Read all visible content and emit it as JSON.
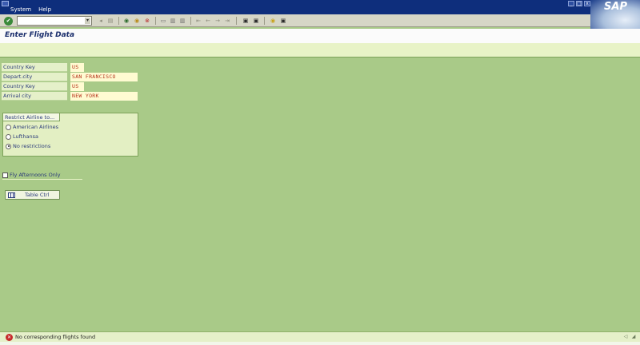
{
  "menu": {
    "items": [
      "System",
      "Help"
    ]
  },
  "window_controls": [
    "_",
    "□",
    "x"
  ],
  "brand": {
    "logo_text": "SAP"
  },
  "toolbar": {
    "command_field_value": "",
    "history_icon": "▾",
    "icons": [
      "enter-icon",
      "back-icon",
      "exit-icon",
      "cancel-icon",
      "print-icon",
      "find-icon",
      "find-next-icon",
      "first-page-icon",
      "prev-page-icon",
      "next-page-icon",
      "last-page-icon",
      "create-session-icon",
      "shortcut-icon",
      "help-icon",
      "layout-menu-icon"
    ]
  },
  "screen": {
    "title": "Enter Flight Data"
  },
  "form": {
    "rows": [
      {
        "label": "Country Key",
        "value": "US"
      },
      {
        "label": "Depart.city",
        "value": "SAN FRANCISCO"
      },
      {
        "label": "Country Key",
        "value": "US"
      },
      {
        "label": "Arrival city",
        "value": "NEW YORK"
      }
    ]
  },
  "restrict_group": {
    "title": "Restrict Airline to...",
    "options": [
      {
        "label": "American Airlines",
        "checked": false
      },
      {
        "label": "Lufthansa",
        "checked": false
      },
      {
        "label": "No restrictions",
        "checked": true
      }
    ]
  },
  "checkbox": {
    "label": "Fly Afternoons Only",
    "checked": false
  },
  "table_button": {
    "label": "Table Ctrl"
  },
  "status": {
    "message": "No corresponding flights found",
    "type": "error"
  },
  "colors": {
    "background": "#a9ca88",
    "title_bar": "#0e2e7c",
    "label_text": "#2a3a7a",
    "value_text": "#b6321a",
    "error": "#c62a2a"
  }
}
